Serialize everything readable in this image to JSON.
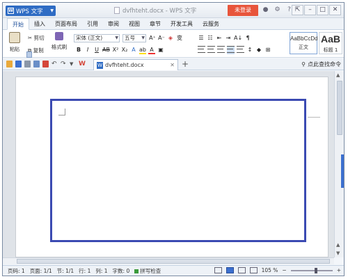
{
  "titlebar": {
    "app_name": "WPS 文字",
    "window_title": "dvfhteht.docx - WPS 文字",
    "login_label": "未登录"
  },
  "menu": {
    "tabs": [
      "开始",
      "插入",
      "页面布局",
      "引用",
      "审阅",
      "视图",
      "章节",
      "开发工具",
      "云服务"
    ],
    "active_index": 0
  },
  "ribbon": {
    "paste_label": "粘贴",
    "cut_label": "剪切",
    "copy_label": "复制",
    "format_painter_label": "格式刷",
    "font_name": "宋体 (正文)",
    "font_size": "五号",
    "styles": [
      {
        "sample": "AaBbCcDd",
        "name": "正文"
      },
      {
        "sample": "AaB",
        "name": "标题 1"
      }
    ]
  },
  "docbar": {
    "tab_name": "dvfhteht.docx",
    "search_label": "点此查找命令"
  },
  "statusbar": {
    "page_num": "页码: 1",
    "pages": "页面: 1/1",
    "section": "节: 1/1",
    "row": "行: 1",
    "col": "列: 1",
    "words": "字数: 0",
    "spell_check": "拼写检查",
    "zoom": "105 %"
  },
  "colors": {
    "accent": "#2f6cc4",
    "login": "#e8553b",
    "annotation": "#3b4ab2"
  }
}
